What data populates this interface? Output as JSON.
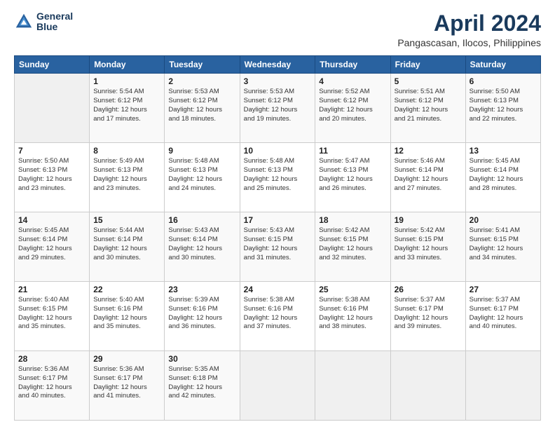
{
  "logo": {
    "line1": "General",
    "line2": "Blue"
  },
  "title": "April 2024",
  "subtitle": "Pangascasan, Ilocos, Philippines",
  "days_header": [
    "Sunday",
    "Monday",
    "Tuesday",
    "Wednesday",
    "Thursday",
    "Friday",
    "Saturday"
  ],
  "weeks": [
    [
      {
        "num": "",
        "info": ""
      },
      {
        "num": "1",
        "info": "Sunrise: 5:54 AM\nSunset: 6:12 PM\nDaylight: 12 hours\nand 17 minutes."
      },
      {
        "num": "2",
        "info": "Sunrise: 5:53 AM\nSunset: 6:12 PM\nDaylight: 12 hours\nand 18 minutes."
      },
      {
        "num": "3",
        "info": "Sunrise: 5:53 AM\nSunset: 6:12 PM\nDaylight: 12 hours\nand 19 minutes."
      },
      {
        "num": "4",
        "info": "Sunrise: 5:52 AM\nSunset: 6:12 PM\nDaylight: 12 hours\nand 20 minutes."
      },
      {
        "num": "5",
        "info": "Sunrise: 5:51 AM\nSunset: 6:12 PM\nDaylight: 12 hours\nand 21 minutes."
      },
      {
        "num": "6",
        "info": "Sunrise: 5:50 AM\nSunset: 6:13 PM\nDaylight: 12 hours\nand 22 minutes."
      }
    ],
    [
      {
        "num": "7",
        "info": "Sunrise: 5:50 AM\nSunset: 6:13 PM\nDaylight: 12 hours\nand 23 minutes."
      },
      {
        "num": "8",
        "info": "Sunrise: 5:49 AM\nSunset: 6:13 PM\nDaylight: 12 hours\nand 23 minutes."
      },
      {
        "num": "9",
        "info": "Sunrise: 5:48 AM\nSunset: 6:13 PM\nDaylight: 12 hours\nand 24 minutes."
      },
      {
        "num": "10",
        "info": "Sunrise: 5:48 AM\nSunset: 6:13 PM\nDaylight: 12 hours\nand 25 minutes."
      },
      {
        "num": "11",
        "info": "Sunrise: 5:47 AM\nSunset: 6:13 PM\nDaylight: 12 hours\nand 26 minutes."
      },
      {
        "num": "12",
        "info": "Sunrise: 5:46 AM\nSunset: 6:14 PM\nDaylight: 12 hours\nand 27 minutes."
      },
      {
        "num": "13",
        "info": "Sunrise: 5:45 AM\nSunset: 6:14 PM\nDaylight: 12 hours\nand 28 minutes."
      }
    ],
    [
      {
        "num": "14",
        "info": "Sunrise: 5:45 AM\nSunset: 6:14 PM\nDaylight: 12 hours\nand 29 minutes."
      },
      {
        "num": "15",
        "info": "Sunrise: 5:44 AM\nSunset: 6:14 PM\nDaylight: 12 hours\nand 30 minutes."
      },
      {
        "num": "16",
        "info": "Sunrise: 5:43 AM\nSunset: 6:14 PM\nDaylight: 12 hours\nand 30 minutes."
      },
      {
        "num": "17",
        "info": "Sunrise: 5:43 AM\nSunset: 6:15 PM\nDaylight: 12 hours\nand 31 minutes."
      },
      {
        "num": "18",
        "info": "Sunrise: 5:42 AM\nSunset: 6:15 PM\nDaylight: 12 hours\nand 32 minutes."
      },
      {
        "num": "19",
        "info": "Sunrise: 5:42 AM\nSunset: 6:15 PM\nDaylight: 12 hours\nand 33 minutes."
      },
      {
        "num": "20",
        "info": "Sunrise: 5:41 AM\nSunset: 6:15 PM\nDaylight: 12 hours\nand 34 minutes."
      }
    ],
    [
      {
        "num": "21",
        "info": "Sunrise: 5:40 AM\nSunset: 6:15 PM\nDaylight: 12 hours\nand 35 minutes."
      },
      {
        "num": "22",
        "info": "Sunrise: 5:40 AM\nSunset: 6:16 PM\nDaylight: 12 hours\nand 35 minutes."
      },
      {
        "num": "23",
        "info": "Sunrise: 5:39 AM\nSunset: 6:16 PM\nDaylight: 12 hours\nand 36 minutes."
      },
      {
        "num": "24",
        "info": "Sunrise: 5:38 AM\nSunset: 6:16 PM\nDaylight: 12 hours\nand 37 minutes."
      },
      {
        "num": "25",
        "info": "Sunrise: 5:38 AM\nSunset: 6:16 PM\nDaylight: 12 hours\nand 38 minutes."
      },
      {
        "num": "26",
        "info": "Sunrise: 5:37 AM\nSunset: 6:17 PM\nDaylight: 12 hours\nand 39 minutes."
      },
      {
        "num": "27",
        "info": "Sunrise: 5:37 AM\nSunset: 6:17 PM\nDaylight: 12 hours\nand 40 minutes."
      }
    ],
    [
      {
        "num": "28",
        "info": "Sunrise: 5:36 AM\nSunset: 6:17 PM\nDaylight: 12 hours\nand 40 minutes."
      },
      {
        "num": "29",
        "info": "Sunrise: 5:36 AM\nSunset: 6:17 PM\nDaylight: 12 hours\nand 41 minutes."
      },
      {
        "num": "30",
        "info": "Sunrise: 5:35 AM\nSunset: 6:18 PM\nDaylight: 12 hours\nand 42 minutes."
      },
      {
        "num": "",
        "info": ""
      },
      {
        "num": "",
        "info": ""
      },
      {
        "num": "",
        "info": ""
      },
      {
        "num": "",
        "info": ""
      }
    ]
  ]
}
